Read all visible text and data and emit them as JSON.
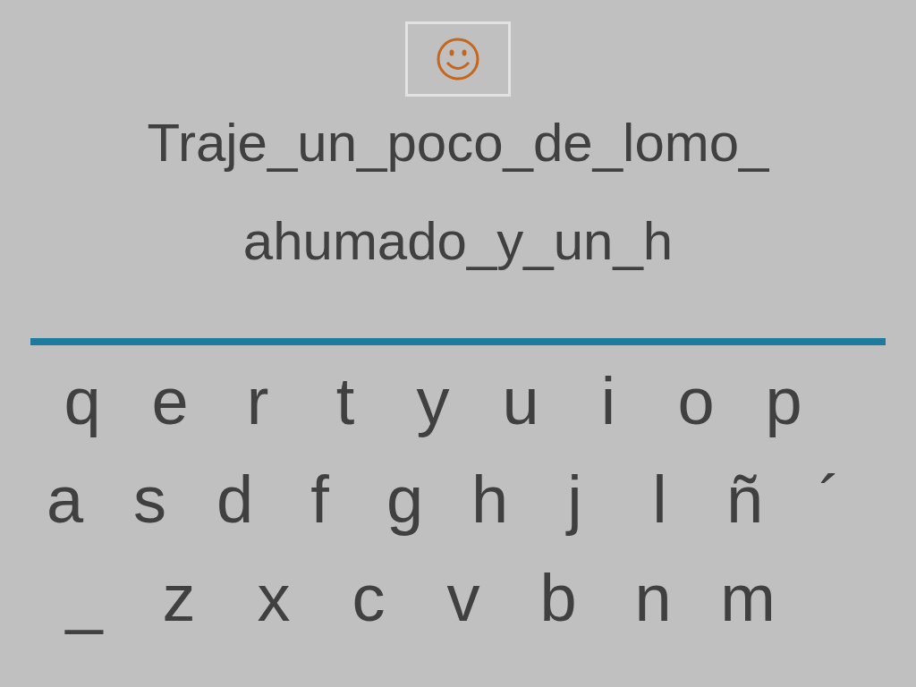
{
  "sentence_lines": [
    "Traje_un_poco_de_lomo_",
    "ahumado_y_un_h"
  ],
  "keyboard_rows": [
    [
      "q",
      "e",
      "r",
      "t",
      "y",
      "u",
      "i",
      "o",
      "p"
    ],
    [
      "a",
      "s",
      "d",
      "f",
      "g",
      "h",
      "j",
      "l",
      "ñ",
      "´"
    ],
    [
      "_",
      "z",
      "x",
      "c",
      "v",
      "b",
      "n",
      "m"
    ]
  ]
}
